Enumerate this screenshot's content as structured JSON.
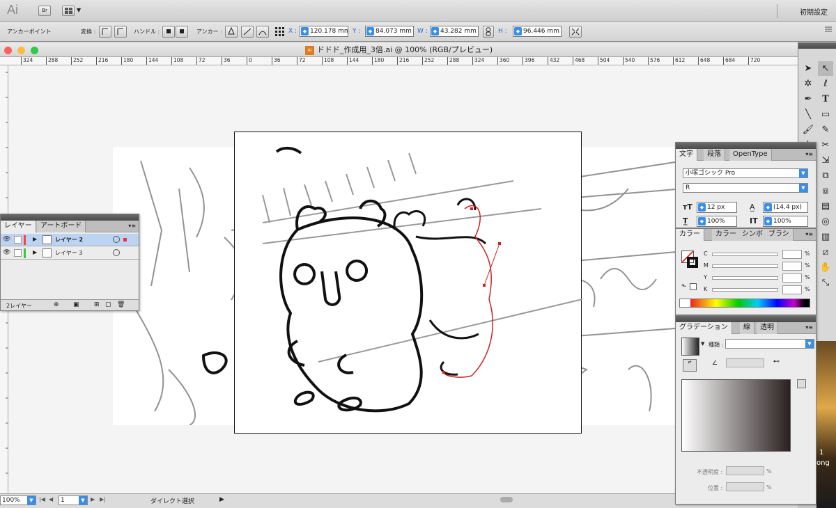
{
  "appbar": {
    "logo": "Ai",
    "bridge": "Br",
    "workspace": "初期設定"
  },
  "control": {
    "anchor_point": "アンカーポイント",
    "transform": "変換 :",
    "handle": "ハンドル :",
    "anchor": "アンカー :",
    "x_label": "X :",
    "x_value": "120.178 mm",
    "y_label": "Y :",
    "y_value": "84.073 mm",
    "w_label": "W :",
    "w_value": "43.282 mm",
    "h_label": "H :",
    "h_value": "96.446 mm"
  },
  "document": {
    "title": "ドドド_作成用_3倍.ai @ 100% (RGB/プレビュー)",
    "file_icon": "Ai"
  },
  "ruler": {
    "ticks": [
      "324",
      "288",
      "252",
      "216",
      "180",
      "144",
      "108",
      "72",
      "36",
      "0",
      "36",
      "72",
      "108",
      "144",
      "180",
      "216",
      "252",
      "288",
      "324",
      "360",
      "396",
      "432",
      "468",
      "504",
      "540",
      "576",
      "612",
      "648",
      "684",
      "720"
    ]
  },
  "status": {
    "zoom": "100%",
    "page": "1",
    "tool": "ダイレクト選択"
  },
  "layers": {
    "tabs": [
      "レイヤー",
      "アートボード"
    ],
    "items": [
      {
        "name": "レイヤー 2",
        "color": "#ff4040",
        "selected": true
      },
      {
        "name": "レイヤー 3",
        "color": "#39c939",
        "selected": false
      }
    ],
    "count": "2レイヤー"
  },
  "type_panel": {
    "tabs": [
      "文字",
      "段落",
      "OpenType"
    ],
    "font": "小塚ゴシック Pro",
    "style": "R",
    "size": "12 px",
    "leading": "(14.4 px)",
    "vscale": "100%",
    "hscale": "100%"
  },
  "color_panel": {
    "tabs": [
      "カラー",
      "カラー",
      "シンボ",
      "ブラシ"
    ],
    "channels": [
      "C",
      "M",
      "Y",
      "K"
    ],
    "pct": "%"
  },
  "gradient_panel": {
    "tabs": [
      "グラデーション",
      "線",
      "透明"
    ],
    "type_label": "種類 :",
    "opacity_label": "不透明度 :",
    "position_label": "位置 :",
    "pct": "%"
  },
  "desktop": {
    "text1": "1",
    "text2": "ong"
  }
}
